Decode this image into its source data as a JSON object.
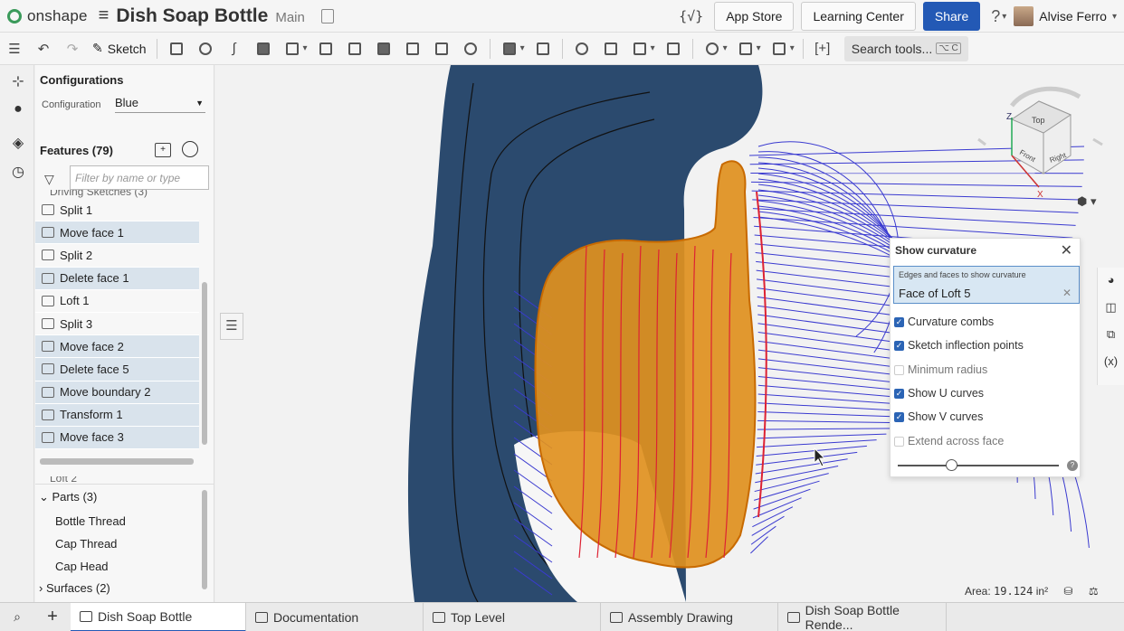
{
  "header": {
    "app_name": "onshape",
    "doc_title": "Dish Soap Bottle",
    "workspace": "Main",
    "code_icon": "{√}",
    "app_store": "App Store",
    "learning_center": "Learning Center",
    "share": "Share",
    "user_name": "Alvise Ferro"
  },
  "toolbar": {
    "sketch_label": "Sketch",
    "search_label": "Search tools...",
    "search_shortcut": "⌥ C"
  },
  "configurations": {
    "title": "Configurations",
    "label": "Configuration",
    "value": "Blue"
  },
  "features": {
    "title": "Features (79)",
    "filter_placeholder": "Filter by name or type",
    "cut_top": "Driving Sketches (3)",
    "items": [
      {
        "label": "Split 1",
        "selected": false
      },
      {
        "label": "Move face 1",
        "selected": true
      },
      {
        "label": "Split 2",
        "selected": false
      },
      {
        "label": "Delete face 1",
        "selected": true
      },
      {
        "label": "Loft 1",
        "selected": false
      },
      {
        "label": "Split 3",
        "selected": false
      },
      {
        "label": "Move face 2",
        "selected": true
      },
      {
        "label": "Delete face 5",
        "selected": true
      },
      {
        "label": "Move boundary 2",
        "selected": true
      },
      {
        "label": "Transform 1",
        "selected": true
      },
      {
        "label": "Move face 3",
        "selected": true
      }
    ],
    "cut_bottom": "Loft 2"
  },
  "parts": {
    "title": "Parts (3)",
    "items": [
      "Bottle Thread",
      "Cap Thread",
      "Cap Head"
    ],
    "surfaces": "Surfaces (2)"
  },
  "curvature_panel": {
    "title": "Show curvature",
    "selection_label": "Edges and faces to show curvature",
    "selection_value": "Face of Loft 5",
    "options": [
      {
        "label": "Curvature combs",
        "checked": true
      },
      {
        "label": "Sketch inflection points",
        "checked": true
      },
      {
        "label": "Minimum radius",
        "checked": false
      },
      {
        "label": "Show U curves",
        "checked": true
      },
      {
        "label": "Show V curves",
        "checked": true
      },
      {
        "label": "Extend across face",
        "checked": false
      }
    ],
    "slider_value": 0.3
  },
  "viewcube": {
    "top": "Top",
    "front": "Front",
    "right": "Right",
    "axis_z": "Z",
    "axis_x": "X"
  },
  "status": {
    "area_label": "Area:",
    "area_value": "19.124",
    "area_unit": "in²"
  },
  "tabs": [
    {
      "label": "Dish Soap Bottle",
      "active": true
    },
    {
      "label": "Documentation",
      "active": false
    },
    {
      "label": "Top Level",
      "active": false
    },
    {
      "label": "Assembly Drawing",
      "active": false
    },
    {
      "label": "Dish Soap Bottle Rende...",
      "active": false
    }
  ],
  "colors": {
    "accent": "#2359b5",
    "bottle": "#2b4a6e",
    "face": "#e0901e",
    "combs": "#3a3ad0"
  }
}
